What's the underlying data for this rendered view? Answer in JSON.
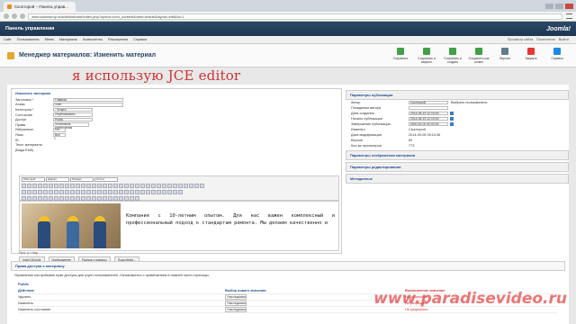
{
  "browser": {
    "tab_title": "Скопторой – Панель управ...",
    "url": "www.salonstroy.ru/administrator/index.php?option=com_content&view=article&layout=edit&id=1"
  },
  "header": {
    "title": "Панель управления",
    "logo": "Joomla!"
  },
  "menubar": {
    "items": [
      "Сайт",
      "Пользователи",
      "Меню",
      "Материалы",
      "Компоненты",
      "Расширения",
      "Справка"
    ],
    "right": [
      "Просмотр сайта",
      "Посетители",
      "Выйти"
    ]
  },
  "toolbar": {
    "title": "Менеджер материалов: Изменить материал",
    "buttons": [
      {
        "label": "Сохранить",
        "color": "#43a047"
      },
      {
        "label": "Сохранить и закрыть",
        "color": "#43a047"
      },
      {
        "label": "Сохранить и создать",
        "color": "#43a047"
      },
      {
        "label": "Сохранить как копию",
        "color": "#43a047"
      },
      {
        "label": "Версии",
        "color": "#607d8b"
      },
      {
        "label": "Закрыть",
        "color": "#e53935"
      },
      {
        "label": "Справка",
        "color": "#1e88e5"
      }
    ]
  },
  "form": {
    "legend": "Изменить материал",
    "fields": [
      {
        "label": "Заголовок *",
        "value": "Главная"
      },
      {
        "label": "Алиас",
        "value": "main"
      },
      {
        "label": "Категория *",
        "value": "- Услуги"
      },
      {
        "label": "Состояние",
        "value": "Опубликовано"
      },
      {
        "label": "Доступ",
        "value": "Public"
      },
      {
        "label": "Права",
        "value": "Установить разрешения"
      },
      {
        "label": "Избранные",
        "value": "Нет"
      },
      {
        "label": "Язык",
        "value": "Все"
      },
      {
        "label": "ID",
        "value": "1"
      },
      {
        "label": "Текст материала",
        "value": ""
      },
      {
        "label": "(Вида Ebilt)",
        "value": ""
      }
    ]
  },
  "overlay_text": "я использую JCE editor",
  "editor": {
    "format_select": "Обычный",
    "font_select": "Шрифт",
    "size_select": "Размер",
    "style_select": "Стили",
    "text": "Компания с 10-летним опытом. Для нас важен комплексный и профессиональный подход к стандартам ремонта. Мы делаем качественно и",
    "status": "Путь: p » img",
    "buttons": [
      "Insert Module",
      "Изображение",
      "Разрыв страницы",
      "Подробнее..."
    ]
  },
  "publishing": {
    "title": "Параметры публикации",
    "rows": [
      {
        "label": "Автор",
        "value": "Скопторой",
        "extra": "Выбрать пользователя"
      },
      {
        "label": "Псевдоним автора",
        "value": ""
      },
      {
        "label": "Дата создания",
        "value": "2014-08-19 12:19:40"
      },
      {
        "label": "Начало публикации",
        "value": "2014-08-19 12:19:40"
      },
      {
        "label": "Завершение публикации",
        "value": "0000-00-00 00:00:00"
      },
      {
        "label": "Изменил",
        "value": "Скопторой"
      },
      {
        "label": "Дата модификации",
        "value": "2014-09-05 05:24:36"
      },
      {
        "label": "Версия",
        "value": "60"
      },
      {
        "label": "Кол-во просмотров",
        "value": "773"
      }
    ],
    "sections": [
      "Параметры отображения материала",
      "Параметры редактирования",
      "Метаданные"
    ]
  },
  "permissions": {
    "title": "Права доступа к материалу",
    "desc": "Управление настройками прав доступа для групп пользователей. Ознакомьтесь с примечанием в нижней части страницы.",
    "group": "Public",
    "headers": [
      "Действие",
      "Выбор нового значения",
      "Вычисленное значение"
    ],
    "rows": [
      {
        "action": "Удалить",
        "setting": "Унаследовано",
        "calc": "Не разрешено"
      },
      {
        "action": "Изменить",
        "setting": "Унаследовано",
        "calc": "Не разрешено"
      },
      {
        "action": "Изменить состояние",
        "setting": "Унаследовано",
        "calc": "Не разрешено"
      }
    ]
  },
  "watermark": "www.paradisevideo.ru"
}
